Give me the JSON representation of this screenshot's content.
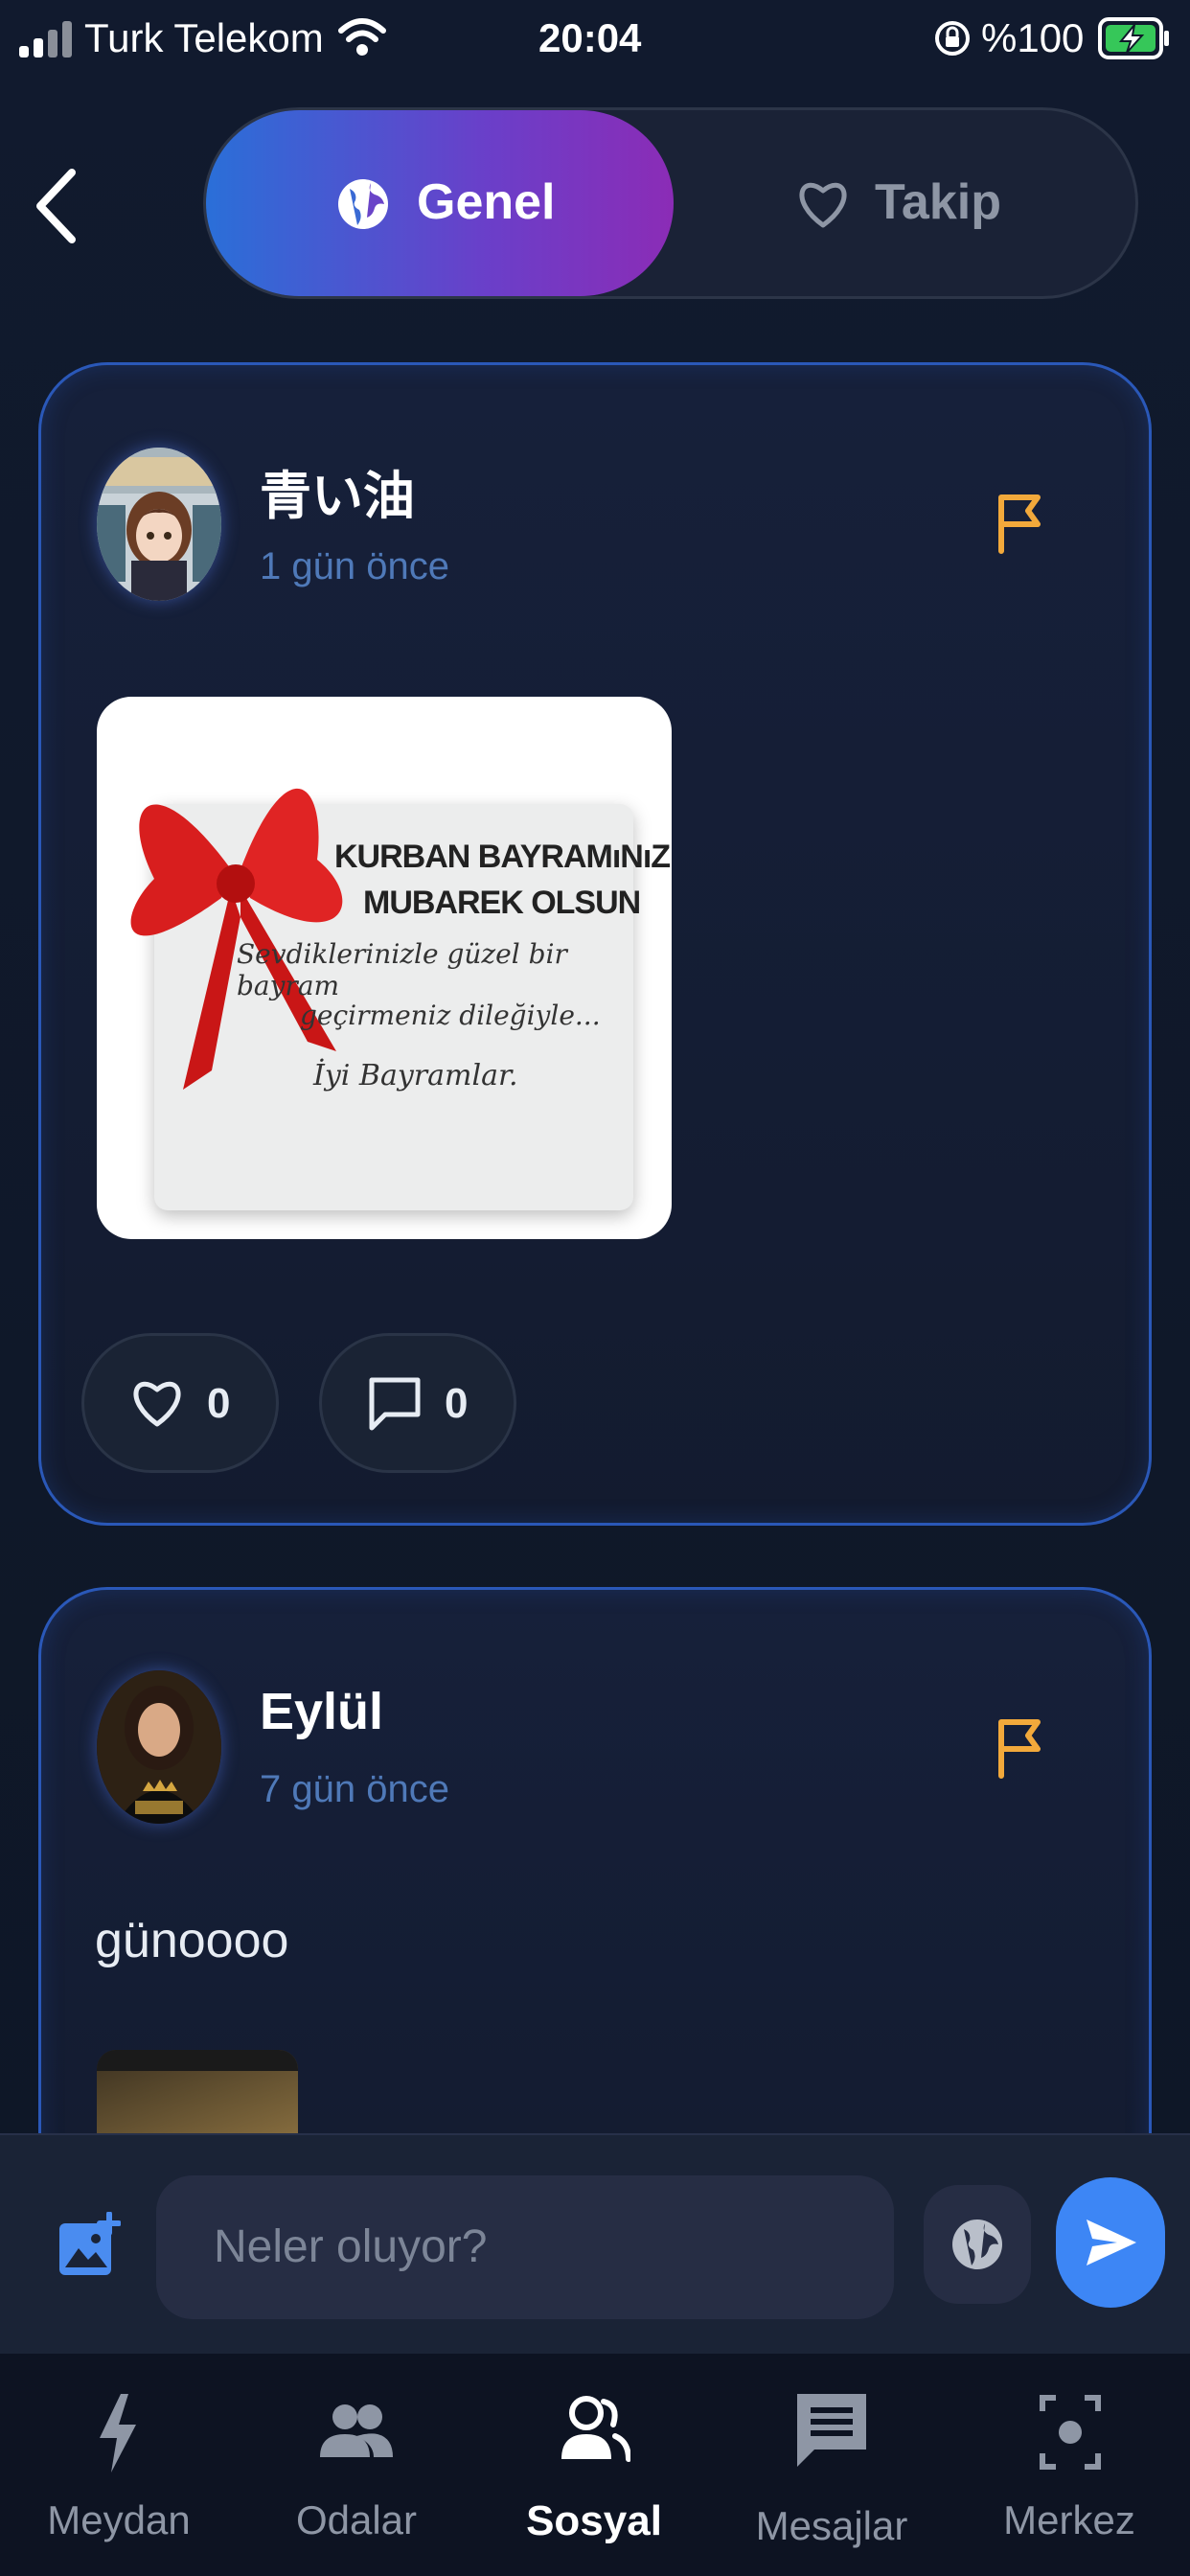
{
  "status_bar": {
    "carrier": "Turk Telekom",
    "time": "20:04",
    "battery": "%100"
  },
  "header": {
    "back_icon": "chevron-left-icon",
    "tabs": [
      {
        "label": "Genel",
        "icon": "globe-icon",
        "active": true
      },
      {
        "label": "Takip",
        "icon": "heart-icon",
        "active": false
      }
    ]
  },
  "posts": [
    {
      "username": "青い油",
      "time": "1 gün önce",
      "image_text": {
        "line1": "KURBAN BAYRAMıNıZ",
        "line2": "MUBAREK OLSUN",
        "line3": "Sevdiklerinizle güzel bir bayram",
        "line4": "geçirmeniz dileğiyle...",
        "line5": "İyi Bayramlar."
      },
      "likes": "0",
      "comments": "0"
    },
    {
      "username": "Eylül",
      "time": "7 gün önce",
      "text": "günoooo"
    }
  ],
  "composer": {
    "placeholder": "Neler oluyor?"
  },
  "nav": {
    "items": [
      {
        "label": "Meydan",
        "icon": "lightning-icon",
        "active": false
      },
      {
        "label": "Odalar",
        "icon": "people-icon",
        "active": false
      },
      {
        "label": "Sosyal",
        "icon": "group-icon",
        "active": true
      },
      {
        "label": "Mesajlar",
        "icon": "message-icon",
        "active": false
      },
      {
        "label": "Merkez",
        "icon": "focus-icon",
        "active": false
      }
    ]
  },
  "colors": {
    "accent": "#3b82f6",
    "flag": "#f2a93b",
    "time_text": "#4f79b8",
    "card_border": "#2a58b8"
  }
}
